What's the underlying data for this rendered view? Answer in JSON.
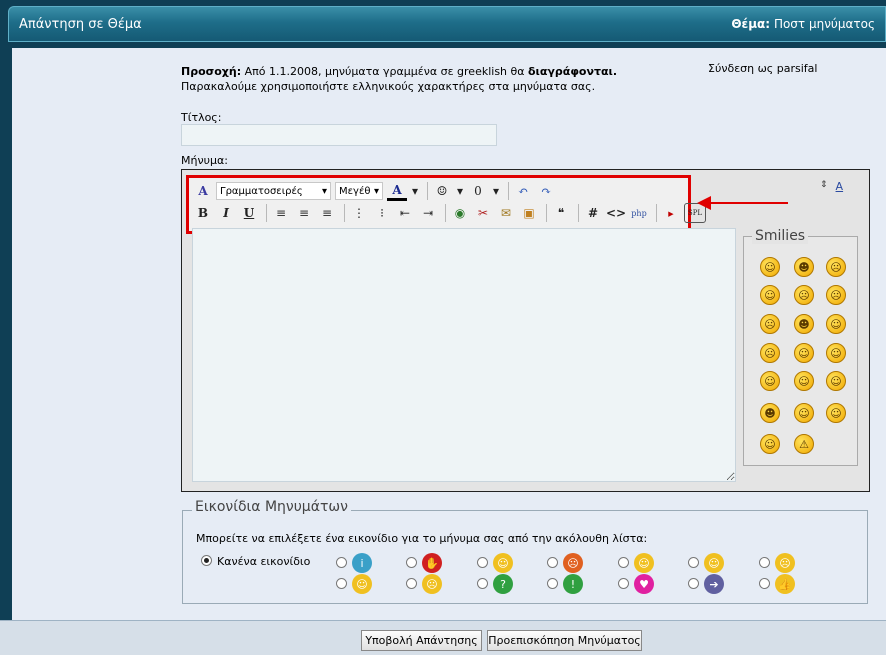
{
  "header": {
    "title": "Απάντηση σε Θέμα",
    "thread_label": "Θέμα:",
    "thread_value": "Ποστ μηνύματος"
  },
  "notice": {
    "warning_label": "Προσοχή:",
    "warning_text_1": "Από 1.1.2008, μηνύματα γραμμένα σε greeklish θα",
    "warning_strong": "διαγράφονται.",
    "warning_text_2": "Παρακαλούμε χρησιμοποιήστε ελληνικούς χαρακτήρες στα μηνύματα σας."
  },
  "login": "Σύνδεση ως parsifal",
  "form": {
    "title_label": "Τίτλος:",
    "title_value": "",
    "message_label": "Μήνυμα:",
    "message_value": ""
  },
  "toolbar": {
    "font_select": "Γραμματοσειρές",
    "size_select": "Μεγέθ"
  },
  "smilies": {
    "title": "Smilies",
    "count": 20
  },
  "post_icons": {
    "legend": "Εικονίδια Μηνυμάτων",
    "description": "Μπορείτε να επιλέξετε ένα εικονίδιο για το μήνυμα σας από την ακόλουθη λίστα:",
    "none_label": "Κανένα εικονίδιο",
    "selected": "none"
  },
  "buttons": {
    "submit": "Υποβολή Απάντησης",
    "preview": "Προεπισκόπηση Μηνύματος"
  },
  "colors": {
    "accent": "#1e6d89",
    "highlight": "#e00000"
  }
}
